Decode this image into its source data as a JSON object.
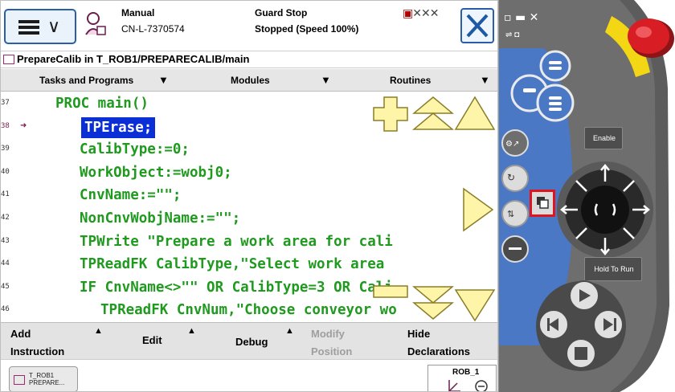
{
  "header": {
    "mode_label": "Manual",
    "controller_id": "CN-L-7370574",
    "guard_label": "Guard Stop",
    "run_state": "Stopped (Speed 100%)"
  },
  "title": "PrepareCalib in T_ROB1/PREPARECALIB/main",
  "tabs": [
    {
      "label": "Tasks and Programs"
    },
    {
      "label": "Modules"
    },
    {
      "label": "Routines"
    }
  ],
  "code_lines": [
    {
      "num": "37",
      "text": "PROC main()"
    },
    {
      "num": "38",
      "text": "TPErase;",
      "selected": true
    },
    {
      "num": "39",
      "text": "CalibType:=0;"
    },
    {
      "num": "40",
      "text": "WorkObject:=wobj0;"
    },
    {
      "num": "41",
      "text": "CnvName:=\"\";"
    },
    {
      "num": "42",
      "text": "NonCnvWobjName:=\"\";"
    },
    {
      "num": "43",
      "text": "TPWrite \"Prepare a work area for cali"
    },
    {
      "num": "44",
      "text": "TPReadFK CalibType,\"Select work area"
    },
    {
      "num": "45",
      "text": "IF CnvName<>\"\" OR CalibType=3 OR Cali"
    },
    {
      "num": "46",
      "text": "TPReadFK CnvNum,\"Choose conveyor wo"
    }
  ],
  "bottom_menu": [
    {
      "line1": "Add",
      "line2": "Instruction"
    },
    {
      "line1": "Edit",
      "line2": ""
    },
    {
      "line1": "Debug",
      "line2": ""
    },
    {
      "line1": "Modify",
      "line2": "Position",
      "disabled": true
    },
    {
      "line1": "Hide",
      "line2": "Declarations"
    }
  ],
  "taskbar": {
    "task_line1": "T_ROB1",
    "task_line2": "PREPARE...",
    "robot_label": "ROB_1"
  },
  "hardware": {
    "enable_label": "Enable",
    "hold_label": "Hold To Run"
  },
  "colors": {
    "code_green": "#1f9a1f",
    "selection_blue": "#0a2fd6",
    "arrow_yellow": "#fff5a8",
    "button_blue": "#2a5fa8",
    "highlight_red": "#e0141c",
    "estop_red": "#d81e24",
    "hw_yellow": "#f3d614"
  }
}
